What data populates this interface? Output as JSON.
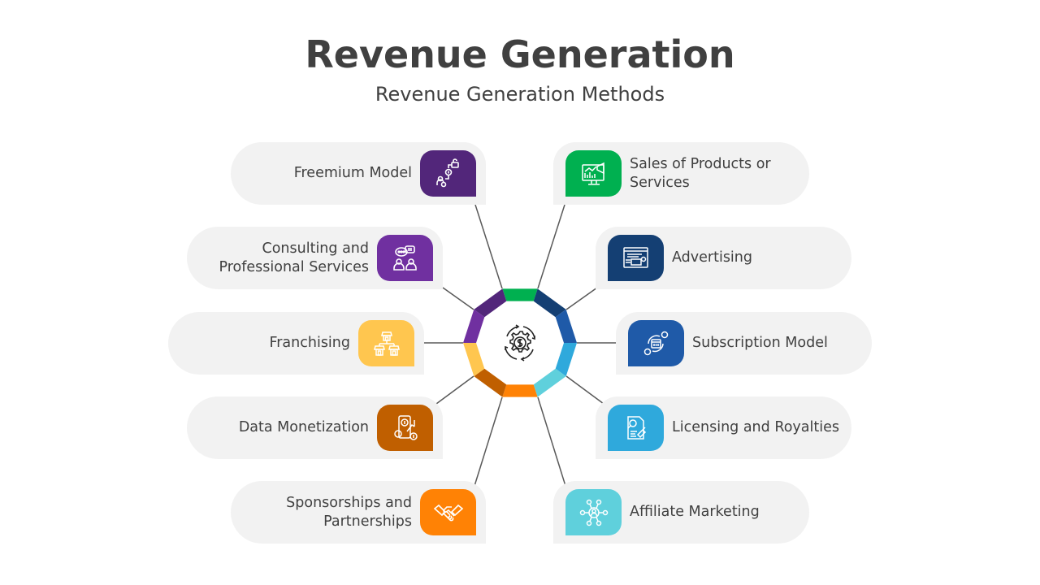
{
  "header": {
    "title": "Revenue Generation",
    "subtitle": "Revenue Generation Methods"
  },
  "center": {
    "icon": "gear-dollar-cycle-icon"
  },
  "items": [
    {
      "id": "freemium",
      "label": "Freemium Model",
      "side": "left",
      "color": "#52267a",
      "icon": "freemium-unlock-dollar-icon"
    },
    {
      "id": "consulting",
      "label": "Consulting and Professional Services",
      "side": "left",
      "color": "#7030a0",
      "icon": "consulting-chat-people-icon"
    },
    {
      "id": "franchising",
      "label": "Franchising",
      "side": "left",
      "color": "#ffc64f",
      "icon": "franchise-stores-icon"
    },
    {
      "id": "data-monetization",
      "label": "Data Monetization",
      "side": "left",
      "color": "#c05f00",
      "icon": "data-monetization-phone-dollar-icon"
    },
    {
      "id": "sponsorships",
      "label": "Sponsorships and Partnerships",
      "side": "left",
      "color": "#ff8205",
      "icon": "handshake-icon"
    },
    {
      "id": "sales",
      "label": "Sales of Products or Services",
      "side": "right",
      "color": "#00b050",
      "icon": "sales-monitor-megaphone-icon"
    },
    {
      "id": "advertising",
      "label": "Advertising",
      "side": "right",
      "color": "#143f73",
      "icon": "advertising-browser-ads-icon"
    },
    {
      "id": "subscription",
      "label": "Subscription Model",
      "side": "right",
      "color": "#1f5aa8",
      "icon": "subscription-cycle-icon"
    },
    {
      "id": "licensing",
      "label": "Licensing and Royalties",
      "side": "right",
      "color": "#2fa9dc",
      "icon": "licensing-document-stamp-icon"
    },
    {
      "id": "affiliate",
      "label": "Affiliate Marketing",
      "side": "right",
      "color": "#5fd0dc",
      "icon": "affiliate-network-icon"
    }
  ],
  "ring_segments": [
    {
      "item": "sales",
      "color": "#00b050"
    },
    {
      "item": "advertising",
      "color": "#143f73"
    },
    {
      "item": "subscription",
      "color": "#1f5aa8"
    },
    {
      "item": "licensing",
      "color": "#2fa9dc"
    },
    {
      "item": "affiliate",
      "color": "#5fd0dc"
    },
    {
      "item": "sponsorships",
      "color": "#ff8205"
    },
    {
      "item": "data-monetization",
      "color": "#c05f00"
    },
    {
      "item": "franchising",
      "color": "#ffc64f"
    },
    {
      "item": "consulting",
      "color": "#7030a0"
    },
    {
      "item": "freemium",
      "color": "#52267a"
    }
  ]
}
